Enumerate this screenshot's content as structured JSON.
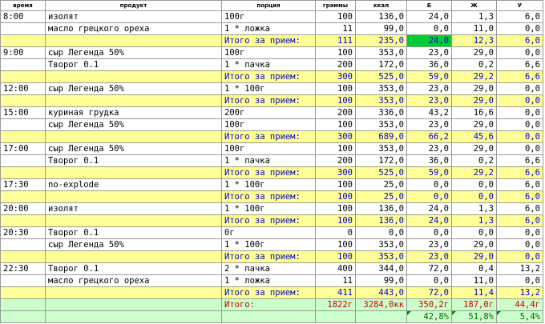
{
  "headers": {
    "time": "время",
    "product": "продукт",
    "portion": "порция",
    "grams": "граммы",
    "kcal": "ккал",
    "b": "Б",
    "zh": "Ж",
    "u": "У"
  },
  "meals": [
    {
      "time": "8:00",
      "items": [
        {
          "product": "изолят",
          "portion": "100г",
          "grams": "100",
          "kcal": "136,0",
          "b": "24,0",
          "zh": "1,3",
          "u": "6,0"
        },
        {
          "product": "масло грецкого ореха",
          "portion": "1 * ложка",
          "grams": "11",
          "kcal": "99,0",
          "b": "0,0",
          "zh": "11,0",
          "u": "0,0"
        }
      ],
      "subtotal": {
        "label": "Итого за прием:",
        "grams": "111",
        "kcal": "235,0",
        "b": "24,0",
        "zh": "12,3",
        "u": "6,0"
      }
    },
    {
      "time": "9:00",
      "items": [
        {
          "product": "сыр Легенда 50%",
          "portion": "100г",
          "grams": "100",
          "kcal": "353,0",
          "b": "23,0",
          "zh": "29,0",
          "u": "0,0"
        },
        {
          "product": "Творог 0.1",
          "portion": "1 * пачка",
          "grams": "200",
          "kcal": "172,0",
          "b": "36,0",
          "zh": "0,2",
          "u": "6,6"
        }
      ],
      "subtotal": {
        "label": "Итого за прием:",
        "grams": "300",
        "kcal": "525,0",
        "b": "59,0",
        "zh": "29,2",
        "u": "6,6"
      }
    },
    {
      "time": "12:00",
      "items": [
        {
          "product": "сыр Легенда 50%",
          "portion": "1 * 100г",
          "grams": "100",
          "kcal": "353,0",
          "b": "23,0",
          "zh": "29,0",
          "u": "0,0"
        }
      ],
      "subtotal": {
        "label": "Итого за прием:",
        "grams": "100",
        "kcal": "353,0",
        "b": "23,0",
        "zh": "29,0",
        "u": "0,0"
      }
    },
    {
      "time": "15:00",
      "items": [
        {
          "product": "куриная грудка",
          "portion": "200г",
          "grams": "200",
          "kcal": "336,0",
          "b": "43,2",
          "zh": "16,6",
          "u": "0,0"
        },
        {
          "product": "сыр Легенда 50%",
          "portion": "100г",
          "grams": "100",
          "kcal": "353,0",
          "b": "23,0",
          "zh": "29,0",
          "u": "0,0"
        }
      ],
      "subtotal": {
        "label": "Итого за прием:",
        "grams": "300",
        "kcal": "689,0",
        "b": "66,2",
        "zh": "45,6",
        "u": "0,0"
      }
    },
    {
      "time": "17:00",
      "items": [
        {
          "product": "сыр Легенда 50%",
          "portion": "100г",
          "grams": "100",
          "kcal": "353,0",
          "b": "23,0",
          "zh": "29,0",
          "u": "0,0"
        },
        {
          "product": "Творог 0.1",
          "portion": "1 * пачка",
          "grams": "200",
          "kcal": "172,0",
          "b": "36,0",
          "zh": "0,2",
          "u": "6,6"
        }
      ],
      "subtotal": {
        "label": "Итого за прием:",
        "grams": "300",
        "kcal": "525,0",
        "b": "59,0",
        "zh": "29,2",
        "u": "6,6"
      }
    },
    {
      "time": "17:30",
      "items": [
        {
          "product": "no-explode",
          "portion": "1 * 100г",
          "grams": "100",
          "kcal": "25,0",
          "b": "0,0",
          "zh": "0,0",
          "u": "6,0"
        }
      ],
      "subtotal": {
        "label": "Итого за прием:",
        "grams": "100",
        "kcal": "25,0",
        "b": "0,0",
        "zh": "0,0",
        "u": "6,0"
      }
    },
    {
      "time": "20:00",
      "items": [
        {
          "product": "изолят",
          "portion": "1 * 100г",
          "grams": "100",
          "kcal": "136,0",
          "b": "24,0",
          "zh": "1,3",
          "u": "6,0"
        }
      ],
      "subtotal": {
        "label": "Итого за прием:",
        "grams": "100",
        "kcal": "136,0",
        "b": "24,0",
        "zh": "1,3",
        "u": "6,0"
      }
    },
    {
      "time": "20:30",
      "items": [
        {
          "product": "Творог 0.1",
          "portion": "0г",
          "grams": "0",
          "kcal": "0,0",
          "b": "0,0",
          "zh": "0,0",
          "u": "0,0"
        },
        {
          "product": "сыр Легенда 50%",
          "portion": "1 * 100г",
          "grams": "100",
          "kcal": "353,0",
          "b": "23,0",
          "zh": "29,0",
          "u": "0,0"
        }
      ],
      "subtotal": {
        "label": "Итого за прием:",
        "grams": "100",
        "kcal": "353,0",
        "b": "23,0",
        "zh": "29,0",
        "u": "0,0"
      }
    },
    {
      "time": "22:30",
      "items": [
        {
          "product": "Творог 0.1",
          "portion": "2 * пачка",
          "grams": "400",
          "kcal": "344,0",
          "b": "72,0",
          "zh": "0,4",
          "u": "13,2"
        },
        {
          "product": "масло грецкого ореха",
          "portion": "1 * ложка",
          "grams": "11",
          "kcal": "99,0",
          "b": "0,0",
          "zh": "11,0",
          "u": "0,0"
        }
      ],
      "subtotal": {
        "label": "Итого за прием:",
        "grams": "411",
        "kcal": "443,0",
        "b": "72,0",
        "zh": "11,4",
        "u": "13,2"
      }
    }
  ],
  "total": {
    "label": "Итого:",
    "grams": "1822г",
    "kcal": "3284,0кк",
    "b": "350,2г",
    "zh": "187,0г",
    "u": "44,4г"
  },
  "percent": {
    "b": "42,8%",
    "zh": "51,8%",
    "u": "5,4%"
  },
  "colors": {
    "subtotal_bg": "#ffff99",
    "subtotal_text": "#0000cc",
    "highlight": "#00cc33",
    "total_bg": "#ccffcc",
    "total_text": "#cc0000",
    "percent_text": "#006600"
  }
}
